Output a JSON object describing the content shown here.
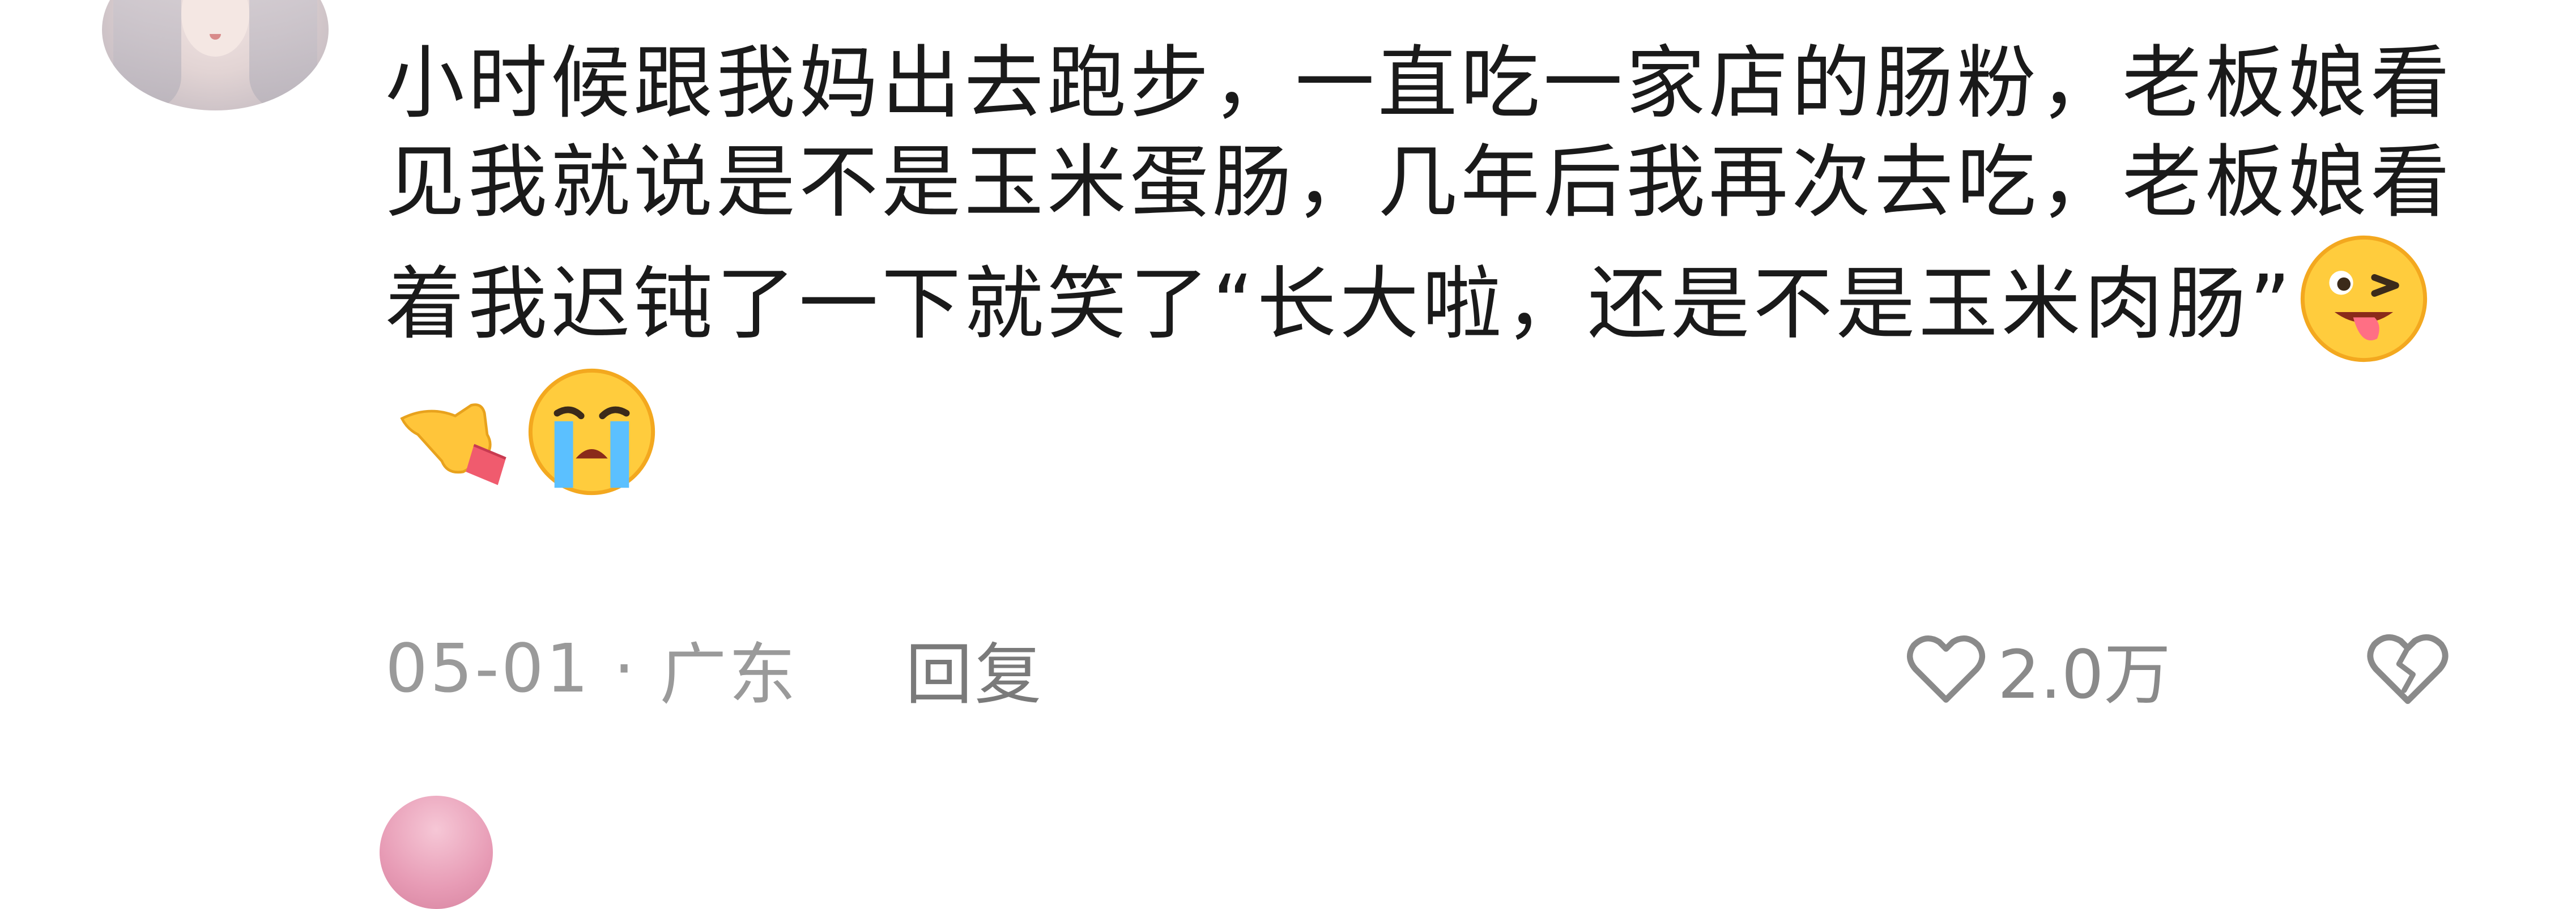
{
  "comment": {
    "text": "小时候跟我妈出去跑步，一直吃一家店的肠粉，老板娘看见我就说是不是玉米蛋肠，几年后我再次去吃，老板娘看着我迟钝了一下就笑了“长大啦，还是不是玉米肉肠”",
    "emojis": [
      "tongue-wink-emoji",
      "pointing-left-hand-emoji",
      "crying-face-emoji"
    ]
  },
  "meta": {
    "date": "05-01",
    "separator": "·",
    "location": "广东",
    "reply_label": "回复"
  },
  "actions": {
    "like_count": "2.0万",
    "like_icon": "heart-outline-icon",
    "dislike_icon": "broken-heart-outline-icon"
  },
  "colors": {
    "text": "#1a1a1a",
    "meta": "#9a9a9a",
    "icon": "#8a8a8a"
  }
}
